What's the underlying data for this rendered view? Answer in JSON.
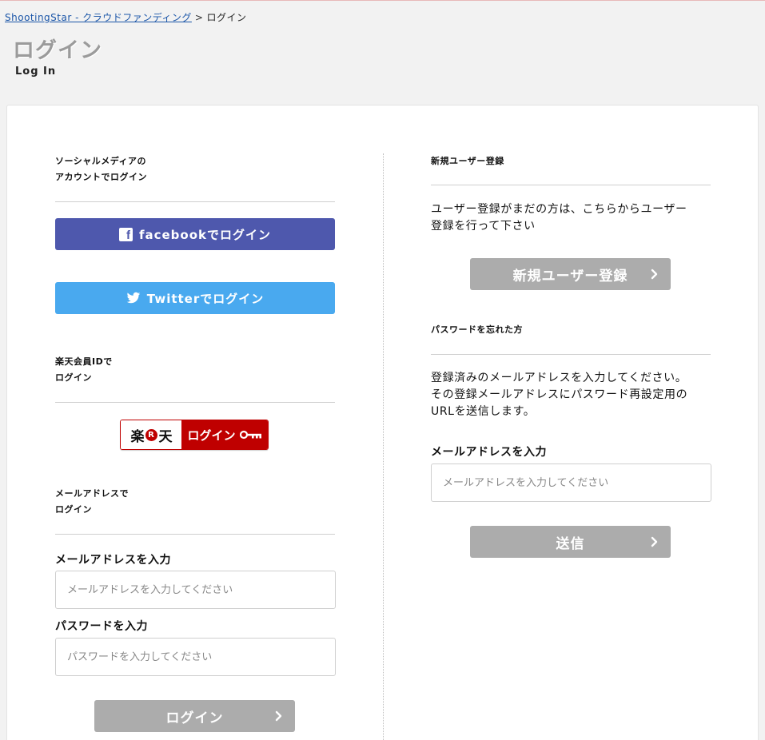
{
  "breadcrumb": {
    "home_link": "ShootingStar - クラウドファンディング",
    "separator": ">",
    "current": "ログイン"
  },
  "page": {
    "title": "ログイン",
    "subtitle": "Log In"
  },
  "social": {
    "heading": "ソーシャルメディアの\nアカウントでログイン",
    "facebook_label": "facebookでログイン",
    "twitter_label": "Twitterでログイン"
  },
  "rakuten": {
    "heading": "楽天会員IDで\nログイン",
    "logo_left": "楽",
    "logo_r": "R",
    "logo_right": "天",
    "action_label": "ログイン"
  },
  "email_login": {
    "heading": "メールアドレスで\nログイン",
    "email_label": "メールアドレスを入力",
    "email_placeholder": "メールアドレスを入力してください",
    "password_label": "パスワードを入力",
    "password_placeholder": "パスワードを入力してください",
    "submit_label": "ログイン"
  },
  "register": {
    "heading": "新規ユーザー登録",
    "description": "ユーザー登録がまだの方は、こちらからユーザー\n登録を行って下さい",
    "button_label": "新規ユーザー登録"
  },
  "forgot": {
    "heading": "パスワードを忘れた方",
    "description": "登録済みのメールアドレスを入力してください。\nその登録メールアドレスにパスワード再設定用の\nURLを送信します。",
    "email_label": "メールアドレスを入力",
    "email_placeholder": "メールアドレスを入力してください",
    "submit_label": "送信"
  },
  "colors": {
    "facebook": "#4e58ad",
    "twitter": "#49a9ef",
    "rakuten": "#bf0000",
    "disabled_button": "#acacac"
  },
  "icons": [
    "facebook-icon",
    "twitter-icon",
    "key-icon",
    "chevron-right-icon"
  ]
}
